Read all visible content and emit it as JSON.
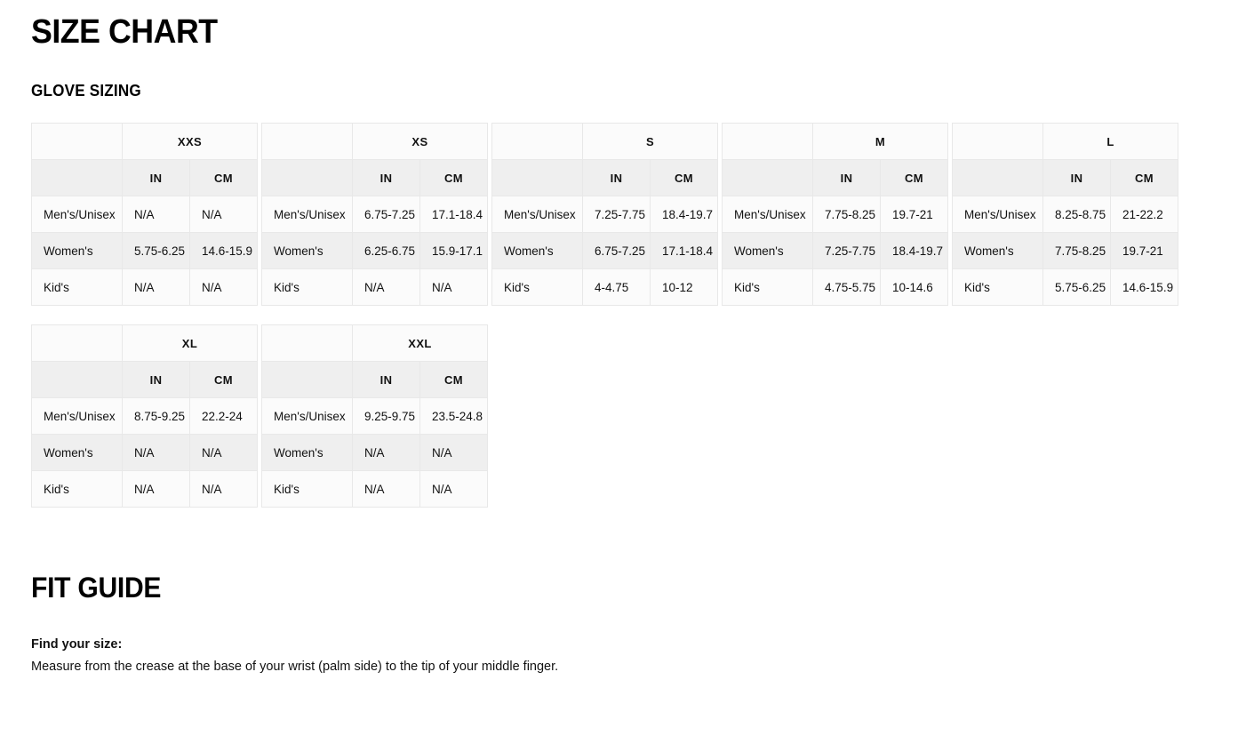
{
  "page": {
    "title": "SIZE CHART",
    "section_heading": "GLOVE SIZING"
  },
  "table_schema": {
    "corner_label": "",
    "unit_in": "IN",
    "unit_cm": "CM",
    "row_labels": [
      "Men's/Unisex",
      "Women's",
      "Kid's"
    ]
  },
  "tables": [
    {
      "size": "XXS",
      "rows": [
        {
          "label": "Men's/Unisex",
          "in": "N/A",
          "cm": "N/A"
        },
        {
          "label": "Women's",
          "in": "5.75-6.25",
          "cm": "14.6-15.9"
        },
        {
          "label": "Kid's",
          "in": "N/A",
          "cm": "N/A"
        }
      ]
    },
    {
      "size": "XS",
      "rows": [
        {
          "label": "Men's/Unisex",
          "in": "6.75-7.25",
          "cm": "17.1-18.4"
        },
        {
          "label": "Women's",
          "in": "6.25-6.75",
          "cm": "15.9-17.1"
        },
        {
          "label": "Kid's",
          "in": "N/A",
          "cm": "N/A"
        }
      ]
    },
    {
      "size": "S",
      "rows": [
        {
          "label": "Men's/Unisex",
          "in": "7.25-7.75",
          "cm": "18.4-19.7"
        },
        {
          "label": "Women's",
          "in": "6.75-7.25",
          "cm": "17.1-18.4"
        },
        {
          "label": "Kid's",
          "in": "4-4.75",
          "cm": "10-12"
        }
      ]
    },
    {
      "size": "M",
      "rows": [
        {
          "label": "Men's/Unisex",
          "in": "7.75-8.25",
          "cm": "19.7-21"
        },
        {
          "label": "Women's",
          "in": "7.25-7.75",
          "cm": "18.4-19.7"
        },
        {
          "label": "Kid's",
          "in": "4.75-5.75",
          "cm": "10-14.6"
        }
      ]
    },
    {
      "size": "L",
      "rows": [
        {
          "label": "Men's/Unisex",
          "in": "8.25-8.75",
          "cm": "21-22.2"
        },
        {
          "label": "Women's",
          "in": "7.75-8.25",
          "cm": "19.7-21"
        },
        {
          "label": "Kid's",
          "in": "5.75-6.25",
          "cm": "14.6-15.9"
        }
      ]
    },
    {
      "size": "XL",
      "rows": [
        {
          "label": "Men's/Unisex",
          "in": "8.75-9.25",
          "cm": "22.2-24"
        },
        {
          "label": "Women's",
          "in": "N/A",
          "cm": "N/A"
        },
        {
          "label": "Kid's",
          "in": "N/A",
          "cm": "N/A"
        }
      ]
    },
    {
      "size": "XXL",
      "rows": [
        {
          "label": "Men's/Unisex",
          "in": "9.25-9.75",
          "cm": "23.5-24.8"
        },
        {
          "label": "Women's",
          "in": "N/A",
          "cm": "N/A"
        },
        {
          "label": "Kid's",
          "in": "N/A",
          "cm": "N/A"
        }
      ]
    }
  ],
  "fit_guide": {
    "heading": "FIT GUIDE",
    "lead": "Find your size:",
    "description": "Measure from the crease at the base of your wrist (palm side) to the tip of your middle finger."
  },
  "colors": {
    "text": "#111111",
    "heading": "#000000",
    "row_light": "#fbfbfb",
    "row_shaded": "#efefef",
    "border": "#e8e8e8"
  }
}
